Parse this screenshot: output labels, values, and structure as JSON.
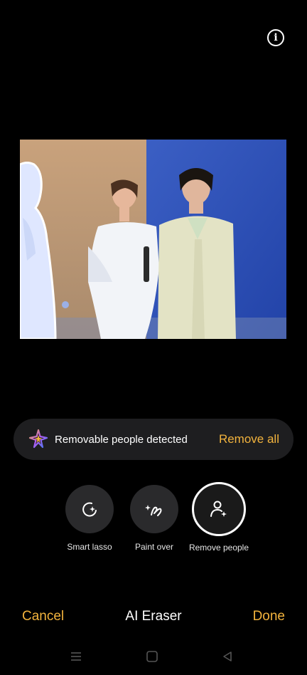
{
  "header": {
    "info_icon": "info-icon"
  },
  "banner": {
    "icon": "sparkle-icon",
    "message": "Removable people detected",
    "action": "Remove all"
  },
  "tools": [
    {
      "label": "Smart lasso",
      "icon": "lasso-sparkle-icon",
      "active": false
    },
    {
      "label": "Paint over",
      "icon": "brush-sparkle-icon",
      "active": false
    },
    {
      "label": "Remove people",
      "icon": "person-sparkle-icon",
      "active": true
    }
  ],
  "bottom_bar": {
    "cancel": "Cancel",
    "title": "AI Eraser",
    "done": "Done"
  },
  "colors": {
    "accent": "#f2b33d",
    "background": "#000000",
    "banner_bg": "#1e1e20",
    "tool_bg": "#2a2a2c"
  },
  "navbar": {
    "icons": [
      "menu-icon",
      "home-square-icon",
      "back-triangle-icon"
    ]
  }
}
